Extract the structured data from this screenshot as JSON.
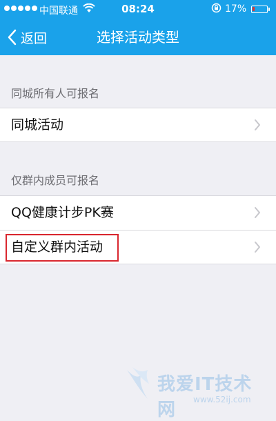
{
  "status_bar": {
    "carrier": "中国联通",
    "time": "08:24",
    "battery_percent": "17%",
    "battery_level": 0.17,
    "battery_color": "#e8312a"
  },
  "nav": {
    "back_label": "返回",
    "title": "选择活动类型"
  },
  "sections": [
    {
      "header": "同城所有人可报名",
      "items": [
        {
          "label": "同城活动"
        }
      ]
    },
    {
      "header": "仅群内成员可报名",
      "items": [
        {
          "label": "QQ健康计步PK赛"
        },
        {
          "label": "自定义群内活动"
        }
      ]
    }
  ],
  "watermark": {
    "text": "我爱IT技术网",
    "url": "www.52ij.com"
  },
  "colors": {
    "brand": "#1aa2ea",
    "highlight": "#d9262e"
  }
}
